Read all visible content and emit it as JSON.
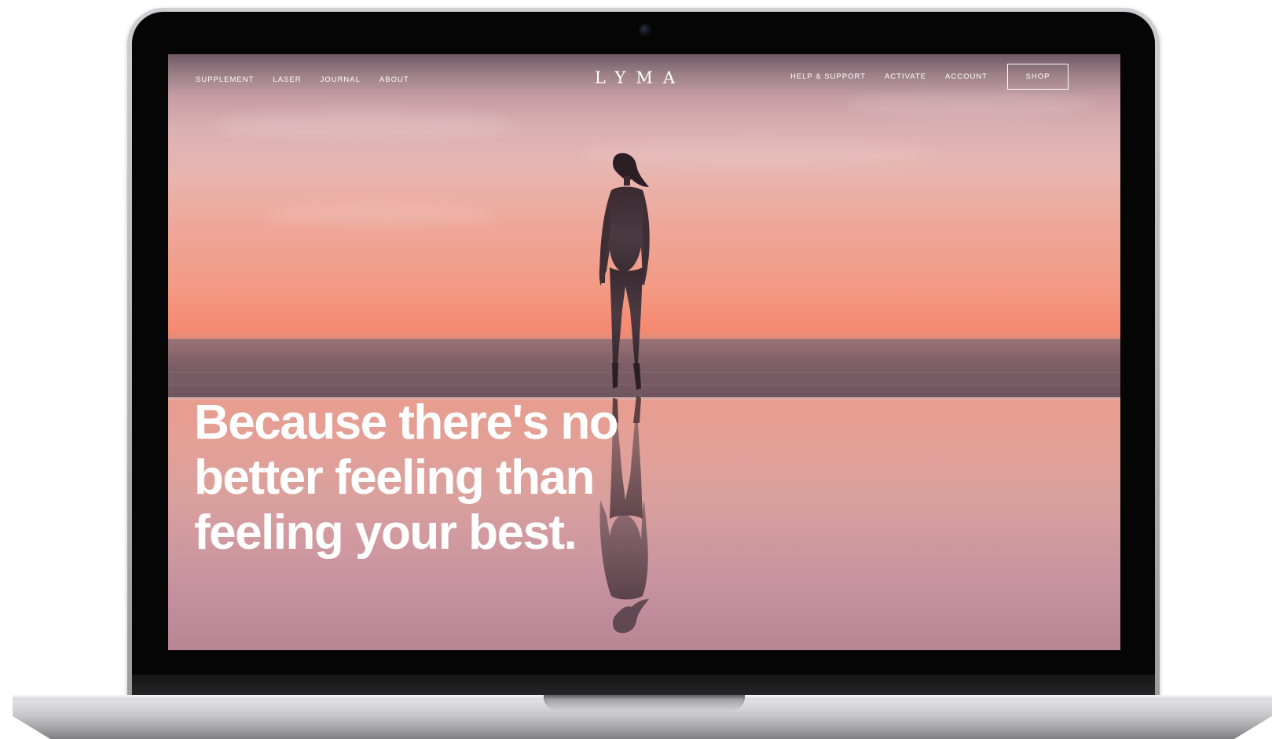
{
  "brand": {
    "logo_text": "LYMA"
  },
  "nav": {
    "left_items": [
      {
        "label": "SUPPLEMENT"
      },
      {
        "label": "LASER"
      },
      {
        "label": "JOURNAL"
      },
      {
        "label": "ABOUT"
      }
    ],
    "right_items": [
      {
        "label": "HELP & SUPPORT"
      },
      {
        "label": "ACTIVATE"
      },
      {
        "label": "ACCOUNT"
      }
    ],
    "shop_label": "SHOP"
  },
  "hero": {
    "headline_lines": [
      "Because there's no",
      "better feeling than",
      "feeling your best."
    ]
  },
  "colors": {
    "nav_text": "#ffffff",
    "headline_text": "#ffffff",
    "sky_top": "#6f5a63",
    "sky_horizon": "#f6876d",
    "pool": "#e3a097",
    "device_frame": "#050505"
  },
  "icons": {
    "camera": "webcam-icon"
  }
}
